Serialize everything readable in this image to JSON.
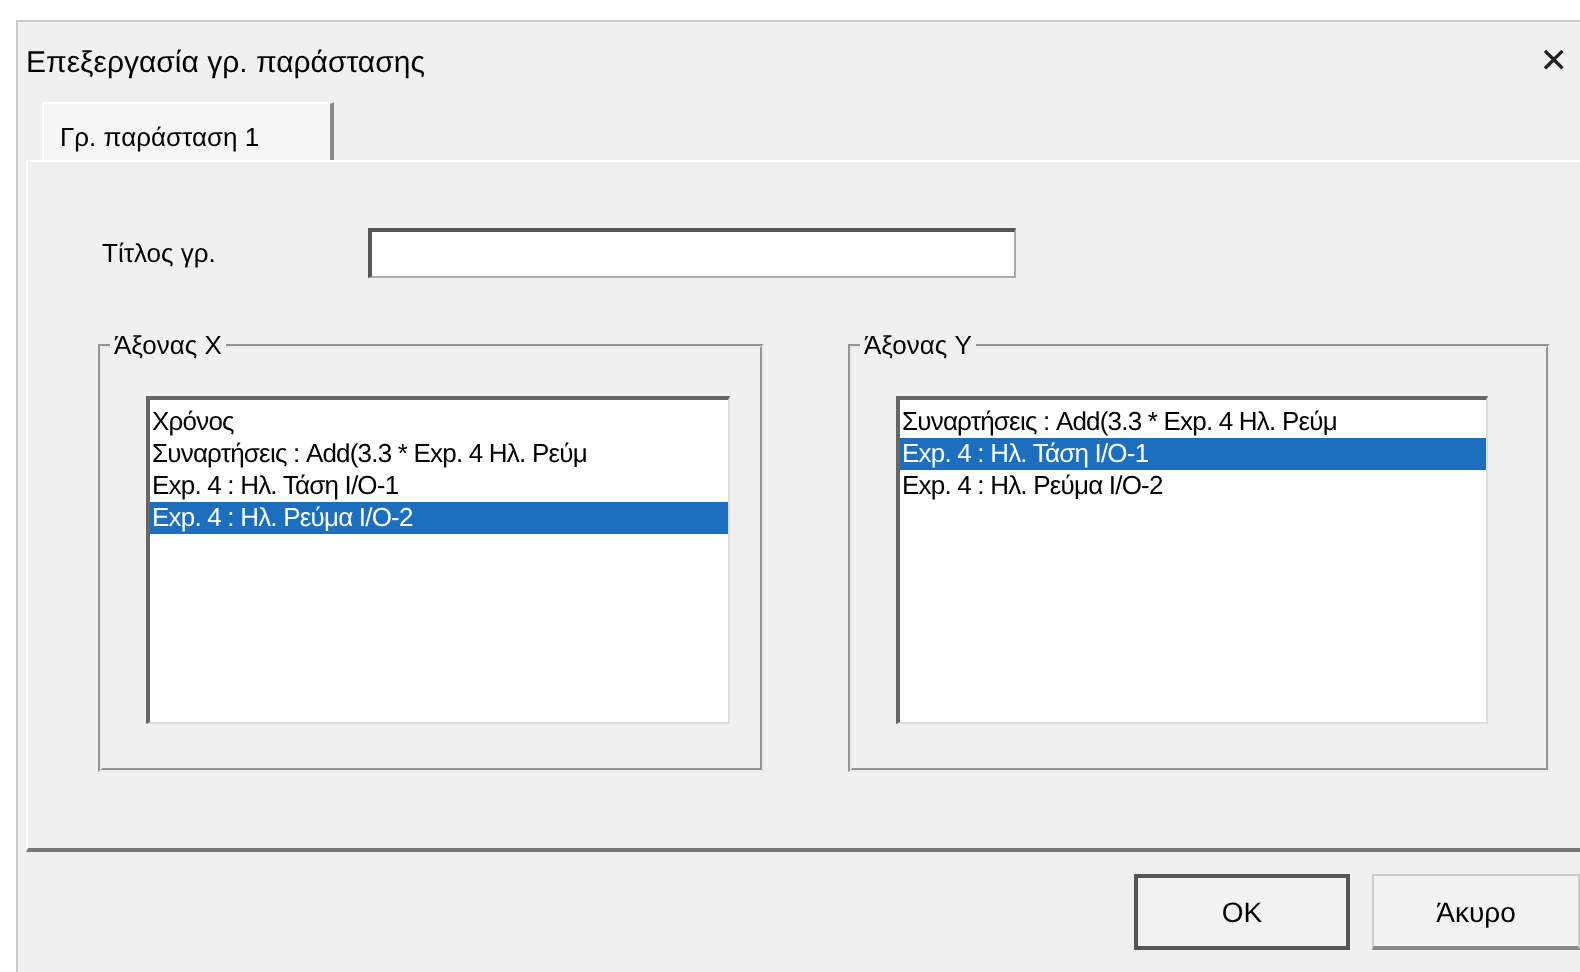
{
  "window": {
    "title": "Επεξεργασία γρ. παράστασης",
    "close": "✕"
  },
  "tabs": [
    {
      "label": "Γρ. παράσταση 1",
      "selected": true
    }
  ],
  "title_field": {
    "label": "Τίτλος γρ."
  },
  "groups": [
    {
      "label": "Άξονας X",
      "items": [
        {
          "text": "Χρόνος",
          "selected": false
        },
        {
          "text": "Συναρτήσεις : Add(3.3 * Exp. 4 Ηλ. Ρεύμ",
          "selected": false
        },
        {
          "text": "Exp. 4 : Ηλ. Τάση I/O-1",
          "selected": false
        },
        {
          "text": "Exp. 4 : Ηλ. Ρεύμα I/O-2",
          "selected": true
        }
      ]
    },
    {
      "label": "Άξονας Y",
      "items": [
        {
          "text": "Συναρτήσεις : Add(3.3 * Exp. 4 Ηλ. Ρεύμ",
          "selected": false
        },
        {
          "text": "Exp. 4 : Ηλ. Τάση I/O-1",
          "selected": true
        },
        {
          "text": "Exp. 4 : Ηλ. Ρεύμα I/O-2",
          "selected": false
        }
      ]
    }
  ],
  "buttons": [
    {
      "label": "OK",
      "kind": "default"
    },
    {
      "label": "Άκυρο",
      "kind": "normal"
    }
  ]
}
